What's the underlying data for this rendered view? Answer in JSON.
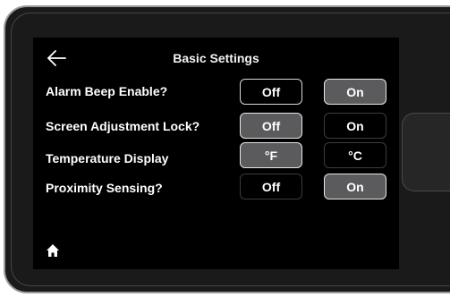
{
  "header": {
    "title": "Basic Settings"
  },
  "settings": [
    {
      "label": "Alarm Beep Enable?",
      "options": [
        "Off",
        "On"
      ],
      "selected": 1
    },
    {
      "label": "Screen Adjustment Lock?",
      "options": [
        "Off",
        "On"
      ],
      "selected": 0
    },
    {
      "label": "Temperature Display",
      "options": [
        "°F",
        "°C"
      ],
      "selected": 0
    },
    {
      "label": "Proximity Sensing?",
      "options": [
        "Off",
        "On"
      ],
      "selected": 1
    }
  ],
  "icons": {
    "back": "back-arrow-icon",
    "home": "home-icon"
  },
  "colors": {
    "screen_bg": "#000000",
    "selected_fill": "#5b5b5e",
    "text": "#ffffff"
  }
}
